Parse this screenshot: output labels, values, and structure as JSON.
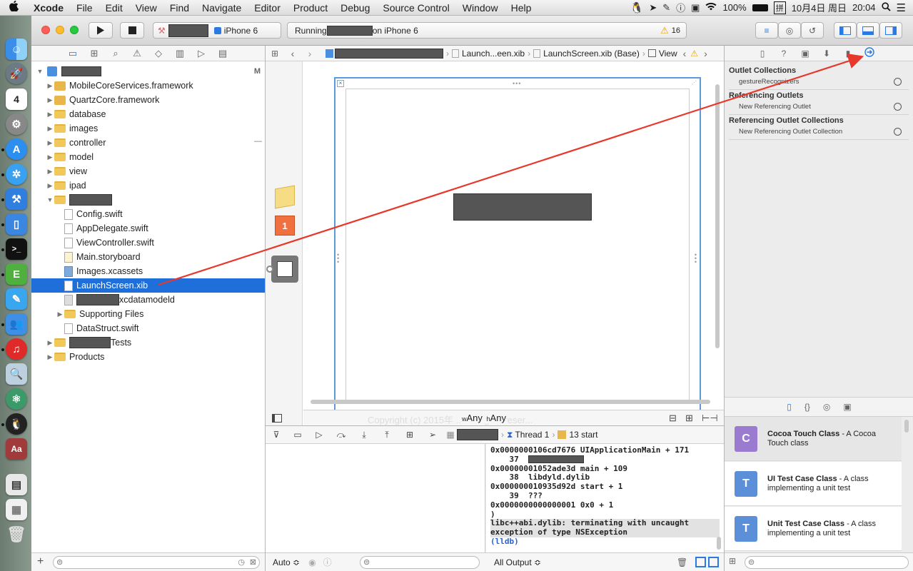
{
  "menubar": {
    "apple": "",
    "items": [
      "Xcode",
      "File",
      "Edit",
      "View",
      "Find",
      "Navigate",
      "Editor",
      "Product",
      "Debug",
      "Source Control",
      "Window",
      "Help"
    ],
    "battery": "100%",
    "ime": "拼",
    "date": "10月4日 周日",
    "time": "20:04"
  },
  "toolbar": {
    "device": "iPhone 6",
    "status_prefix": "Running",
    "status_suffix": "on iPhone 6",
    "warning_count": "16"
  },
  "navigator": {
    "root_badge": "M",
    "minus": "—",
    "items": [
      {
        "label": "MobileCoreServices.framework",
        "kind": "framework",
        "indent": 1,
        "disclosure": "▶"
      },
      {
        "label": "QuartzCore.framework",
        "kind": "framework",
        "indent": 1,
        "disclosure": "▶"
      },
      {
        "label": "database",
        "kind": "folder",
        "indent": 1,
        "disclosure": "▶"
      },
      {
        "label": "images",
        "kind": "folder",
        "indent": 1,
        "disclosure": "▶"
      },
      {
        "label": "controller",
        "kind": "folder",
        "indent": 1,
        "disclosure": "▶"
      },
      {
        "label": "model",
        "kind": "folder",
        "indent": 1,
        "disclosure": "▶"
      },
      {
        "label": "view",
        "kind": "folder",
        "indent": 1,
        "disclosure": "▶"
      },
      {
        "label": "ipad",
        "kind": "folder",
        "indent": 1,
        "disclosure": "▶"
      },
      {
        "label": "",
        "kind": "folder",
        "indent": 1,
        "disclosure": "▼"
      },
      {
        "label": "Config.swift",
        "kind": "swift",
        "indent": 2,
        "disclosure": ""
      },
      {
        "label": "AppDelegate.swift",
        "kind": "swift",
        "indent": 2,
        "disclosure": ""
      },
      {
        "label": "ViewController.swift",
        "kind": "swift",
        "indent": 2,
        "disclosure": ""
      },
      {
        "label": "Main.storyboard",
        "kind": "storyboard",
        "indent": 2,
        "disclosure": ""
      },
      {
        "label": "Images.xcassets",
        "kind": "assets",
        "indent": 2,
        "disclosure": ""
      },
      {
        "label": "LaunchScreen.xib",
        "kind": "xib",
        "indent": 2,
        "disclosure": "",
        "selected": true
      },
      {
        "label": "xcdatamodeld",
        "kind": "datamodel",
        "indent": 2,
        "disclosure": ""
      },
      {
        "label": "Supporting Files",
        "kind": "folder",
        "indent": 2,
        "disclosure": "▶"
      },
      {
        "label": "DataStruct.swift",
        "kind": "swift",
        "indent": 2,
        "disclosure": ""
      },
      {
        "label": "Tests",
        "kind": "folder",
        "indent": 1,
        "disclosure": "▶"
      },
      {
        "label": "Products",
        "kind": "folder",
        "indent": 1,
        "disclosure": "▶"
      }
    ]
  },
  "jumpbar": {
    "crumb1": "Launch...een.xib",
    "crumb2": "LaunchScreen.xib (Base)",
    "crumb3": "View"
  },
  "canvas": {
    "size_w_prefix": "w",
    "size_w": "Any",
    "size_h_prefix": "h",
    "size_h": "Any",
    "faded_copyright": "Copyright (c) 2015年 ... All rights reser..."
  },
  "debugbar": {
    "thread": "Thread 1",
    "frame": "13 start"
  },
  "console": {
    "lines": [
      {
        "text": "0x0000000106cd7676 UIApplicationMain + 171",
        "style": ""
      },
      {
        "text": "    37  ",
        "style": "",
        "redact": true
      },
      {
        "text": "0x00000001052ade3d main + 109",
        "style": ""
      },
      {
        "text": "    38  libdyld.dylib",
        "style": ""
      },
      {
        "text": "0x000000010935d92d start + 1",
        "style": ""
      },
      {
        "text": "    39  ???",
        "style": ""
      },
      {
        "text": "0x0000000000000001 0x0 + 1",
        "style": ""
      },
      {
        "text": ")",
        "style": ""
      },
      {
        "text": "libc++abi.dylib: terminating with uncaught",
        "style": "hl"
      },
      {
        "text": "exception of type NSException",
        "style": "hl"
      },
      {
        "text": "(lldb)",
        "style": "lldb"
      }
    ]
  },
  "debug_footer": {
    "auto": "Auto ≎",
    "output": "All Output ≎"
  },
  "inspector": {
    "sections": [
      {
        "title": "Outlet Collections",
        "rows": [
          "gestureRecognizers"
        ]
      },
      {
        "title": "Referencing Outlets",
        "rows": [
          "New Referencing Outlet"
        ]
      },
      {
        "title": "Referencing Outlet Collections",
        "rows": [
          "New Referencing Outlet Collection"
        ]
      }
    ],
    "library": [
      {
        "title": "Cocoa Touch Class",
        "desc": " - A Cocoa Touch class",
        "icon": "C",
        "color": "#9b7bd0"
      },
      {
        "title": "UI Test Case Class",
        "desc": " - A class implementing a unit test",
        "icon": "T",
        "color": "#5b8fd8"
      },
      {
        "title": "Unit Test Case Class",
        "desc": " - A class implementing a unit test",
        "icon": "T",
        "color": "#5b8fd8"
      }
    ]
  },
  "colors": {
    "selection": "#1e6fd9",
    "arrow": "#e8372b",
    "accent": "#2a7ae2"
  }
}
